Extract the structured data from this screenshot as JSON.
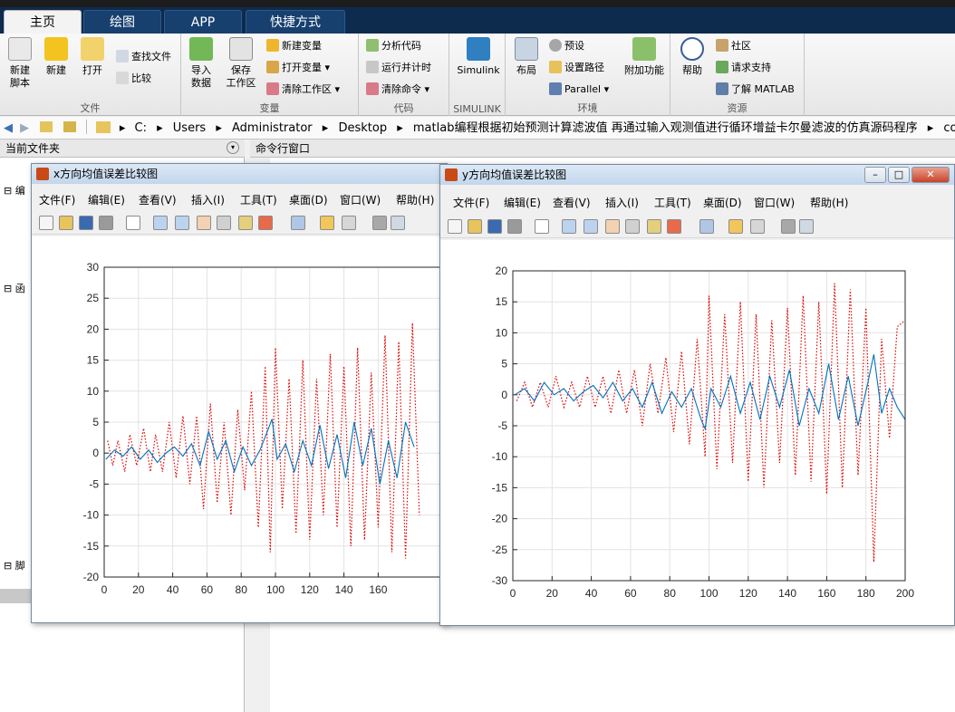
{
  "tabs": [
    {
      "label": "主页"
    },
    {
      "label": "绘图"
    },
    {
      "label": "APP"
    },
    {
      "label": "快捷方式"
    }
  ],
  "ribbon": {
    "file": {
      "label": "文件",
      "new_script": "新建\n脚本",
      "new": "新建",
      "open": "打开",
      "find_files": "查找文件",
      "compare": "比较"
    },
    "variable": {
      "label": "变量",
      "import": "导入\n数据",
      "save": "保存\n工作区",
      "new_var": "新建变量",
      "open_var": "打开变量",
      "clear_ws": "清除工作区"
    },
    "code": {
      "label": "代码",
      "analyze": "分析代码",
      "run_time": "运行并计时",
      "clear_cmd": "清除命令"
    },
    "simulink": {
      "label": "SIMULINK",
      "button": "Simulink"
    },
    "env": {
      "label": "环境",
      "layout": "布局",
      "prefs": "预设",
      "set_path": "设置路径",
      "parallel": "Parallel",
      "addons": "附加功能"
    },
    "resources": {
      "label": "资源",
      "help": "帮助",
      "community": "社区",
      "request": "请求支持",
      "learn": "了解 MATLAB"
    }
  },
  "address": {
    "parts": [
      "C:",
      "Users",
      "Administrator",
      "Desktop",
      "matlab编程根据初始预测计算滤波值 再通过输入观测值进行循环增益卡尔曼滤波的仿真源码程序",
      "code"
    ]
  },
  "panels": {
    "current_folder": "当前文件夹",
    "command_window": "命令行窗口",
    "left_labels": [
      "编",
      "函",
      "脚"
    ]
  },
  "menus": [
    "文件(F)",
    "编辑(E)",
    "查看(V)",
    "插入(I)",
    "工具(T)",
    "桌面(D)",
    "窗口(W)",
    "帮助(H)"
  ],
  "fig1": {
    "title": "x方向均值误差比较图"
  },
  "fig2": {
    "title": "y方向均值误差比较图"
  },
  "colors": {
    "estimate": "#0072bd",
    "measurement": "#e00000"
  },
  "chart_data": [
    {
      "type": "line",
      "xlim": [
        0,
        200
      ],
      "ylim": [
        -20,
        30
      ],
      "x_ticks": [
        0,
        20,
        40,
        60,
        80,
        100,
        120,
        140,
        160
      ],
      "y_ticks": [
        -20,
        -15,
        -10,
        -5,
        0,
        5,
        10,
        15,
        20,
        25,
        30
      ],
      "grid": true,
      "series": [
        {
          "style": "solid",
          "x": [
            1,
            6,
            11,
            16,
            21,
            26,
            31,
            36,
            41,
            46,
            51,
            56,
            61,
            66,
            71,
            76,
            81,
            86,
            91,
            96,
            98,
            101,
            106,
            111,
            116,
            121,
            126,
            131,
            136,
            141,
            146,
            151,
            156,
            161,
            166,
            171,
            176,
            181
          ],
          "y": [
            -1,
            0.5,
            -0.5,
            1,
            -1,
            0.5,
            -1.5,
            0,
            1,
            -0.5,
            1.5,
            -2,
            3.5,
            -1,
            2,
            -3,
            1,
            -2,
            0.5,
            4,
            5.5,
            -1,
            1.5,
            -3,
            2,
            -2,
            4.5,
            -2.5,
            3,
            -4,
            5,
            -2,
            4,
            -5,
            2,
            -4,
            5,
            1
          ]
        },
        {
          "style": "dotted",
          "x": [
            2,
            5,
            8,
            12,
            15,
            19,
            23,
            27,
            30,
            34,
            38,
            42,
            46,
            50,
            54,
            58,
            62,
            66,
            70,
            74,
            78,
            82,
            86,
            90,
            94,
            97,
            100,
            104,
            108,
            112,
            116,
            120,
            124,
            128,
            132,
            136,
            140,
            144,
            148,
            152,
            156,
            160,
            164,
            168,
            172,
            176,
            180,
            184
          ],
          "y": [
            2,
            -2,
            2,
            -3,
            3,
            -2,
            4,
            -3,
            3,
            -3,
            5,
            -4,
            6,
            -5,
            6,
            -9,
            8,
            -8,
            5,
            -10,
            7,
            -6,
            10,
            -12,
            14,
            -16,
            17,
            -9,
            12,
            -13,
            15,
            -14,
            12,
            -10,
            16,
            -12,
            14,
            -15,
            17,
            -14,
            13,
            -12,
            19,
            -16,
            18,
            -17,
            21,
            -10
          ]
        }
      ]
    },
    {
      "type": "line",
      "xlim": [
        0,
        200
      ],
      "ylim": [
        -30,
        20
      ],
      "x_ticks": [
        0,
        20,
        40,
        60,
        80,
        100,
        120,
        140,
        160,
        180,
        200
      ],
      "y_ticks": [
        -30,
        -25,
        -20,
        -15,
        -10,
        -5,
        0,
        5,
        10,
        15,
        20
      ],
      "grid": true,
      "series": [
        {
          "style": "solid",
          "x": [
            1,
            6,
            11,
            16,
            21,
            26,
            31,
            36,
            41,
            46,
            51,
            56,
            61,
            66,
            71,
            76,
            81,
            86,
            91,
            96,
            98,
            101,
            106,
            111,
            116,
            121,
            126,
            131,
            136,
            141,
            146,
            151,
            156,
            161,
            166,
            171,
            176,
            181,
            184,
            188,
            192,
            196,
            200
          ],
          "y": [
            0,
            1,
            -1,
            2,
            0,
            1,
            -1,
            0.5,
            1.5,
            -0.5,
            2,
            -1,
            1,
            -2,
            2,
            -3,
            0.5,
            -2,
            1,
            -4,
            -5.5,
            1,
            -2,
            3,
            -3,
            2,
            -4,
            3,
            -2,
            4,
            -5,
            1,
            -3,
            5,
            -4,
            3,
            -5,
            2,
            6.5,
            -3,
            1,
            -2,
            -4
          ]
        },
        {
          "style": "dotted",
          "x": [
            2,
            6,
            10,
            14,
            18,
            22,
            26,
            30,
            34,
            38,
            42,
            46,
            50,
            54,
            58,
            62,
            66,
            70,
            74,
            78,
            82,
            86,
            90,
            94,
            98,
            100,
            104,
            108,
            112,
            116,
            120,
            124,
            128,
            132,
            136,
            140,
            144,
            148,
            152,
            156,
            160,
            164,
            168,
            172,
            176,
            180,
            184,
            188,
            192,
            196,
            200
          ],
          "y": [
            -1,
            2,
            -2,
            2,
            -2,
            3,
            -2,
            2,
            -2,
            3,
            -2,
            3,
            -3,
            4,
            -3,
            4,
            -5,
            5,
            -3,
            6,
            -6,
            7,
            -8,
            9,
            -10,
            16,
            -12,
            13,
            -11,
            15,
            -14,
            13,
            -15,
            12,
            -11,
            14,
            -13,
            16,
            -14,
            15,
            -16,
            18,
            -15,
            17,
            -13,
            14,
            -27,
            9,
            -7,
            11,
            12
          ]
        }
      ]
    }
  ]
}
